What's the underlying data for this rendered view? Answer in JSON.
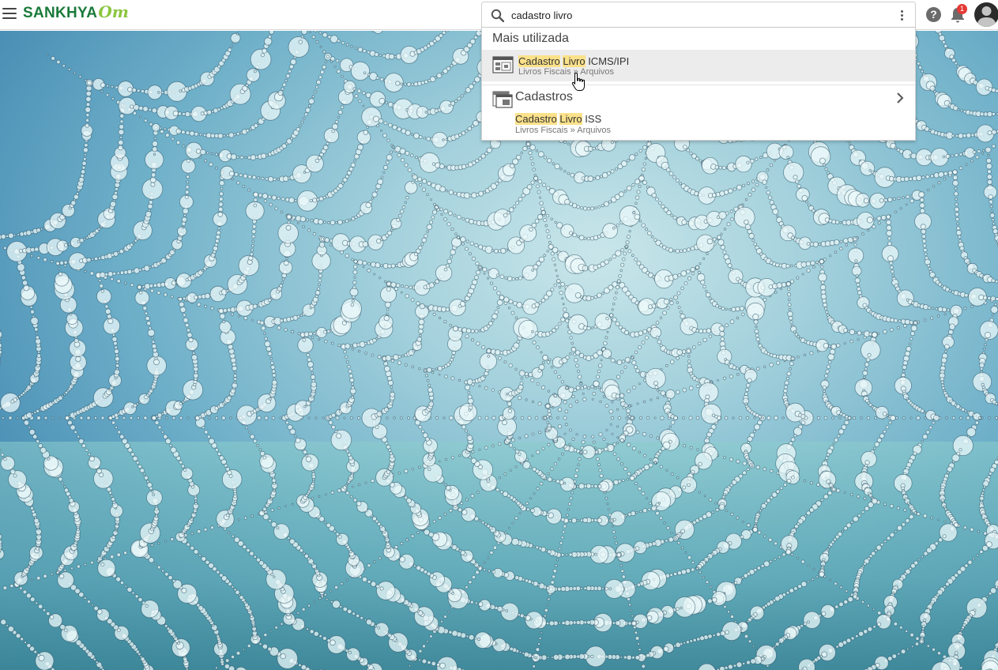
{
  "header": {
    "logo_text": "SANKHYA",
    "logo_suffix": "Om",
    "notification_count": "1",
    "help_glyph": "?"
  },
  "search": {
    "value": "cadastro livro",
    "placeholder": ""
  },
  "results": {
    "section_title": "Mais utilizada",
    "top_item": {
      "title_parts": [
        "Cadastro",
        "Livro",
        "ICMS/IPI"
      ],
      "path": "Livros Fiscais » Arquivos"
    },
    "group": {
      "label": "Cadastros",
      "item": {
        "title_parts": [
          "Cadastro",
          "Livro",
          "ISS"
        ],
        "path": "Livros Fiscais » Arquivos"
      }
    }
  },
  "icons": {
    "menu": "hamburger-icon",
    "search": "search-icon",
    "more": "kebab-icon",
    "help": "help-icon",
    "notifications": "bell-icon",
    "user": "avatar-icon",
    "screen": "window-icon",
    "expand": "chevron-right-icon"
  },
  "colors": {
    "brand": "#1a7a3a",
    "brand_accent": "#8cc63f",
    "match_highlight": "#fbe18a",
    "badge": "#e53935"
  }
}
